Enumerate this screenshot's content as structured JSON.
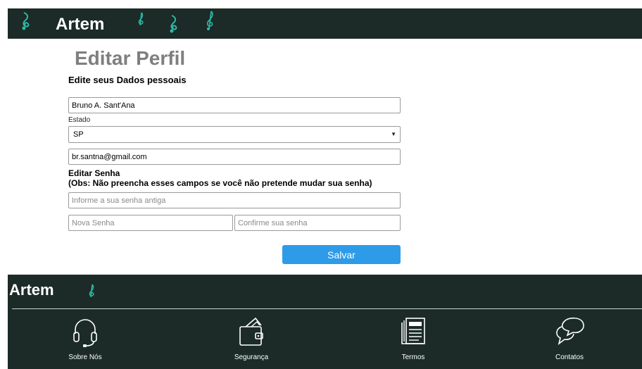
{
  "header": {
    "brand": "Artem",
    "icons": [
      "music-note-icon",
      "treble-clef-icon"
    ]
  },
  "main": {
    "title": "Editar Perfil",
    "subtitle": "Edite seus Dados pessoais",
    "name_value": "Bruno A. Sant'Ana",
    "state_label": "Estado",
    "state_value": "SP",
    "email_value": "br.santna@gmail.com",
    "password_heading": "Editar Senha",
    "password_note": "(Obs: Não preencha esses campos se você não pretende mudar sua senha)",
    "old_password_placeholder": "Informe a sua senha antiga",
    "new_password_placeholder": "Nova Senha",
    "confirm_password_placeholder": "Confirme sua senha",
    "save_label": "Salvar"
  },
  "footer": {
    "brand": "Artem",
    "nav": [
      {
        "label": "Sobre Nós",
        "icon": "headset-icon"
      },
      {
        "label": "Segurança",
        "icon": "wallet-icon"
      },
      {
        "label": "Termos",
        "icon": "newspaper-icon"
      },
      {
        "label": "Contatos",
        "icon": "chat-bubbles-icon"
      }
    ]
  },
  "colors": {
    "header_bg": "#1c2b27",
    "accent_note": "#2db9a8",
    "save_button": "#2d9be8",
    "title_gray": "#7f7f7f"
  }
}
